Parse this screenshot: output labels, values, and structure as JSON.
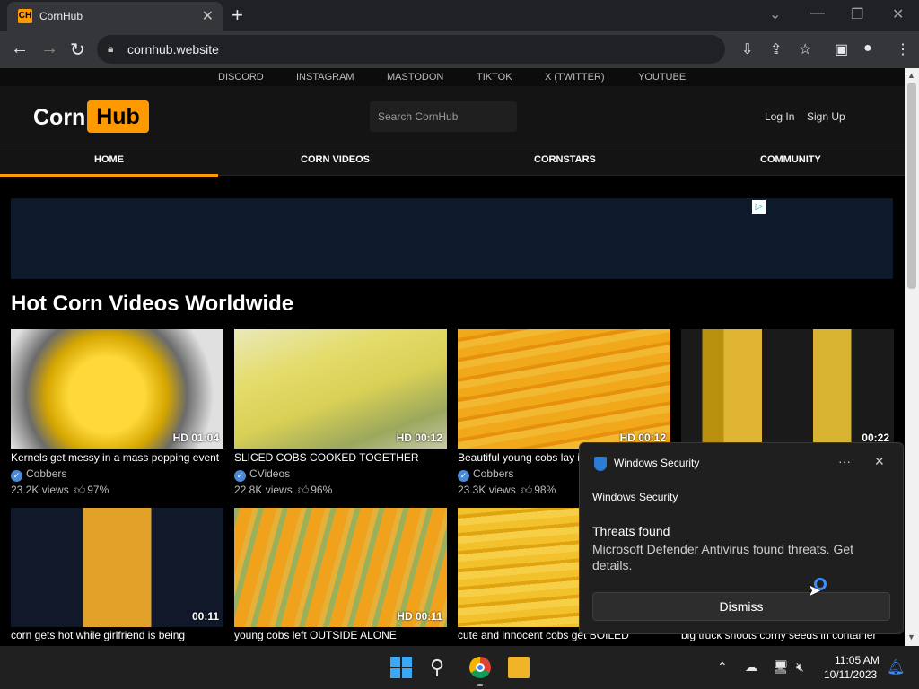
{
  "browser": {
    "tab_title": "CornHub",
    "tab_favicon": "CH",
    "new_tab": "+",
    "url": "cornhub.website"
  },
  "site": {
    "social_links": [
      "DISCORD",
      "INSTAGRAM",
      "MASTODON",
      "TIKTOK",
      "X (TWITTER)",
      "YOUTUBE"
    ],
    "logo_left": "Corn",
    "logo_right": "Hub",
    "search_placeholder": "Search CornHub",
    "login": "Log In",
    "signup": "Sign Up",
    "nav": [
      "HOME",
      "CORN VIDEOS",
      "CORNSTARS",
      "COMMUNITY"
    ],
    "active_nav": "HOME",
    "section_title": "Hot Corn Videos Worldwide",
    "accent_color": "#ff9900"
  },
  "videos": [
    {
      "title": "Kernels get messy in a mass popping event",
      "channel": "Cobbers",
      "views": "23.2K views",
      "rating": "97%",
      "duration": "HD 01:04"
    },
    {
      "title": "SLICED COBS COOKED TOGETHER",
      "channel": "CVideos",
      "views": "22.8K views",
      "rating": "96%",
      "duration": "HD 00:12"
    },
    {
      "title": "Beautiful young cobs lay i",
      "channel": "Cobbers",
      "views": "23.3K views",
      "rating": "98%",
      "duration": "HD 00:12"
    },
    {
      "title": "",
      "channel": "",
      "views": "",
      "rating": "",
      "duration": "00:22"
    },
    {
      "title": "corn gets hot while girlfriend is being",
      "duration": "00:11"
    },
    {
      "title": "young cobs left OUTSIDE ALONE",
      "duration": "HD 00:11"
    },
    {
      "title": "cute and innocent cobs get BOILED",
      "duration": ""
    },
    {
      "title": "big truck shoots corny seeds in container",
      "duration": ""
    }
  ],
  "toast": {
    "app_name": "Windows Security",
    "source": "Windows Security",
    "heading": "Threats found",
    "body": "Microsoft Defender Antivirus found threats. Get details.",
    "dismiss": "Dismiss",
    "more": "···",
    "close": "✕"
  },
  "taskbar": {
    "time": "11:05 AM",
    "date": "10/11/2023"
  }
}
